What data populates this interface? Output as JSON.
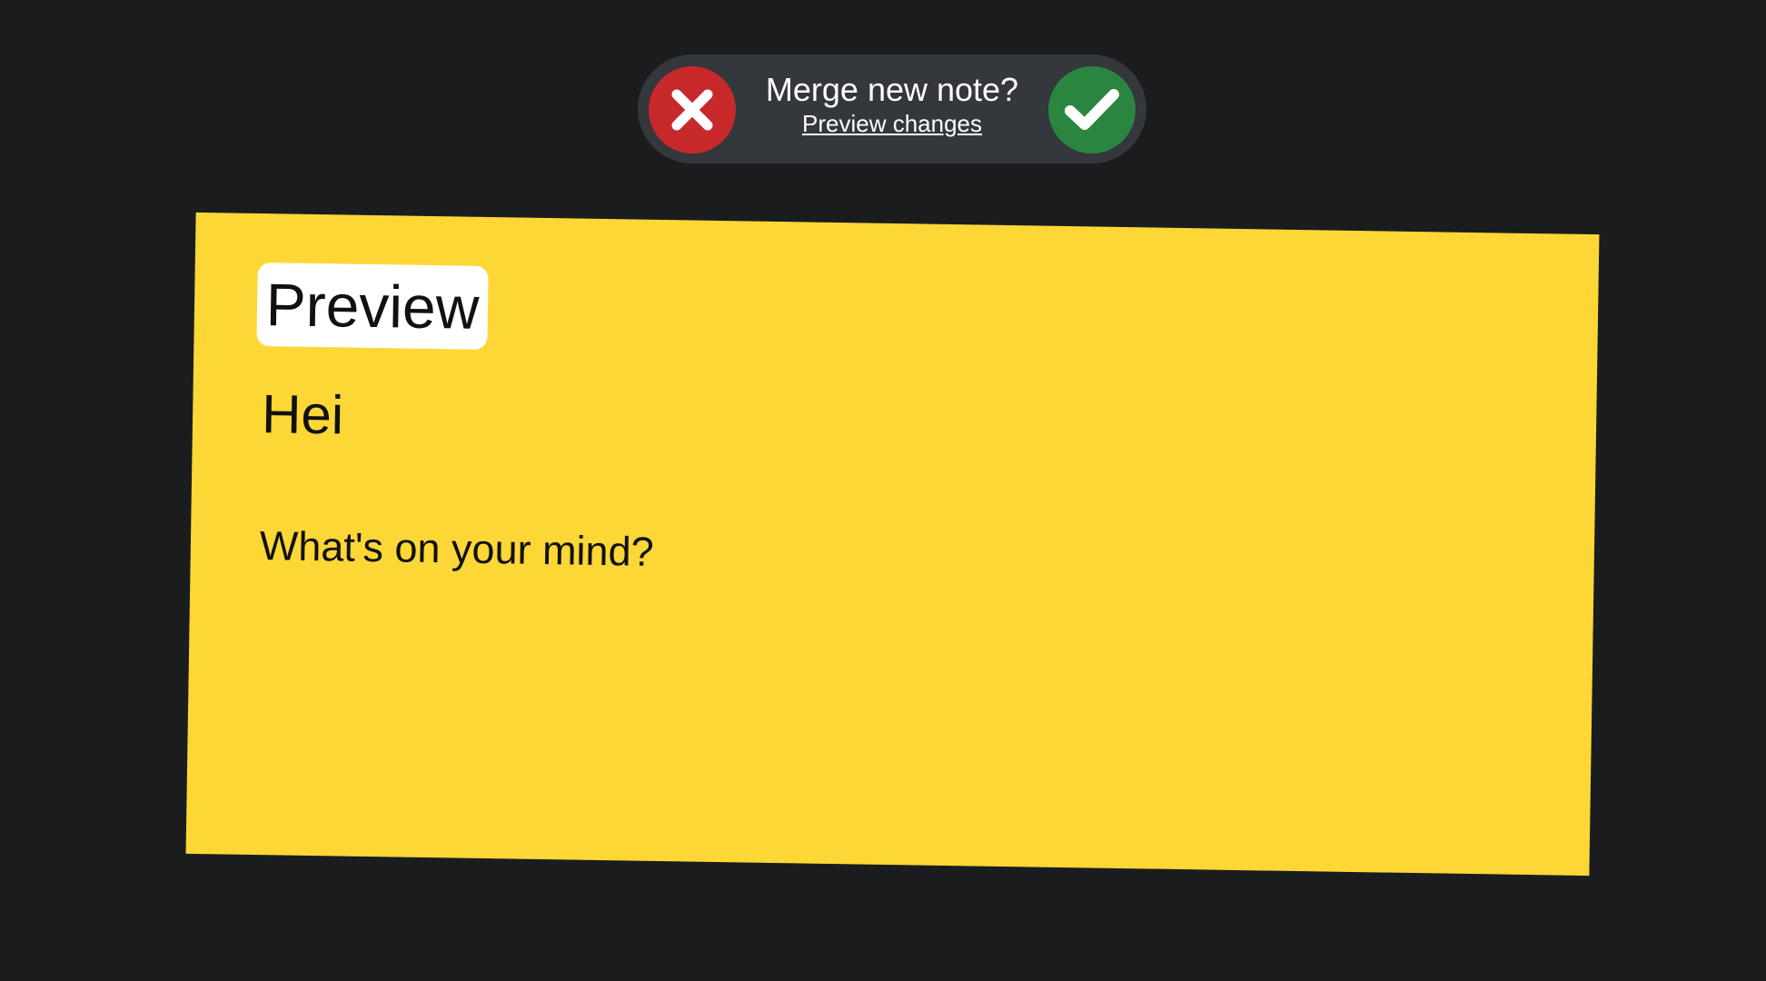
{
  "merge_prompt": {
    "question": "Merge new note?",
    "preview_link": "Preview changes",
    "reject_icon": "close-icon",
    "accept_icon": "check-icon",
    "reject_color": "#c7292b",
    "accept_color": "#2a8541"
  },
  "note": {
    "badge": "Preview",
    "title": "Hei",
    "body": "What's on your mind?",
    "background_color": "#fdd736"
  }
}
